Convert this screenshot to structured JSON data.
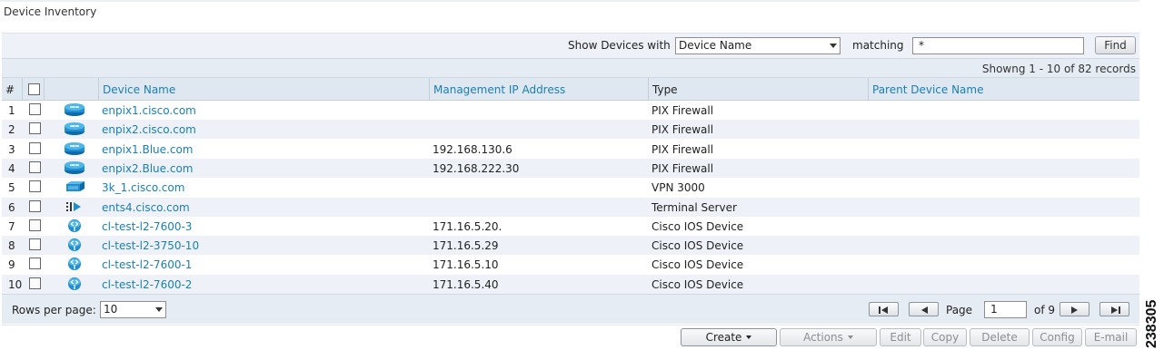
{
  "page": {
    "title": "Device Inventory"
  },
  "filter": {
    "show_label": "Show Devices with",
    "field_value": "Device Name",
    "matching_label": "matching",
    "match_value": "*",
    "find_label": "Find"
  },
  "records_text": "Showng 1 - 10 of 82 records",
  "table": {
    "headers": {
      "num": "#",
      "device_name": "Device Name",
      "mgmt_ip": "Management IP Address",
      "type": "Type",
      "parent": "Parent Device Name"
    },
    "rows": [
      {
        "num": "1",
        "icon": "firewall-icon",
        "name": "enpix1.cisco.com",
        "ip": "",
        "type": "PIX Firewall",
        "parent": ""
      },
      {
        "num": "2",
        "icon": "firewall-icon",
        "name": "enpix2.cisco.com",
        "ip": "",
        "type": "PIX Firewall",
        "parent": ""
      },
      {
        "num": "3",
        "icon": "firewall-icon",
        "name": "enpix1.Blue.com",
        "ip": "192.168.130.6",
        "type": "PIX Firewall",
        "parent": ""
      },
      {
        "num": "4",
        "icon": "firewall-icon",
        "name": "enpix2.Blue.com",
        "ip": "192.168.222.30",
        "type": "PIX Firewall",
        "parent": ""
      },
      {
        "num": "5",
        "icon": "vpn-concentrator-icon",
        "name": "3k_1.cisco.com",
        "ip": "",
        "type": "VPN 3000",
        "parent": ""
      },
      {
        "num": "6",
        "icon": "terminal-server-icon",
        "name": "ents4.cisco.com",
        "ip": "",
        "type": "Terminal Server",
        "parent": ""
      },
      {
        "num": "7",
        "icon": "ios-router-icon",
        "name": "cl-test-l2-7600-3",
        "ip": "171.16.5.20.",
        "type": "Cisco IOS Device",
        "parent": ""
      },
      {
        "num": "8",
        "icon": "ios-router-icon",
        "name": "cl-test-l2-3750-10",
        "ip": "171.16.5.29",
        "type": "Cisco IOS Device",
        "parent": ""
      },
      {
        "num": "9",
        "icon": "ios-router-icon",
        "name": "cl-test-l2-7600-1",
        "ip": "171.16.5.10",
        "type": "Cisco IOS Device",
        "parent": ""
      },
      {
        "num": "10",
        "icon": "ios-router-icon",
        "name": "cl-test-l2-7600-2",
        "ip": "171.16.5.40",
        "type": "Cisco IOS Device",
        "parent": ""
      }
    ]
  },
  "pager": {
    "rows_per_page_label": "Rows per page:",
    "rows_per_page_value": "10",
    "page_label": "Page",
    "page_value": "1",
    "of_label": "of 9"
  },
  "actions": {
    "create": "Create",
    "actions": "Actions",
    "edit": "Edit",
    "copy": "Copy",
    "delete": "Delete",
    "config": "Config",
    "email": "E-mail"
  },
  "side_id": "238305",
  "colors": {
    "link": "#1a7fb4",
    "header_bg": "#dfe7f1",
    "alt_row": "#eef2f8",
    "icon_blue": "#1f8fd1"
  }
}
